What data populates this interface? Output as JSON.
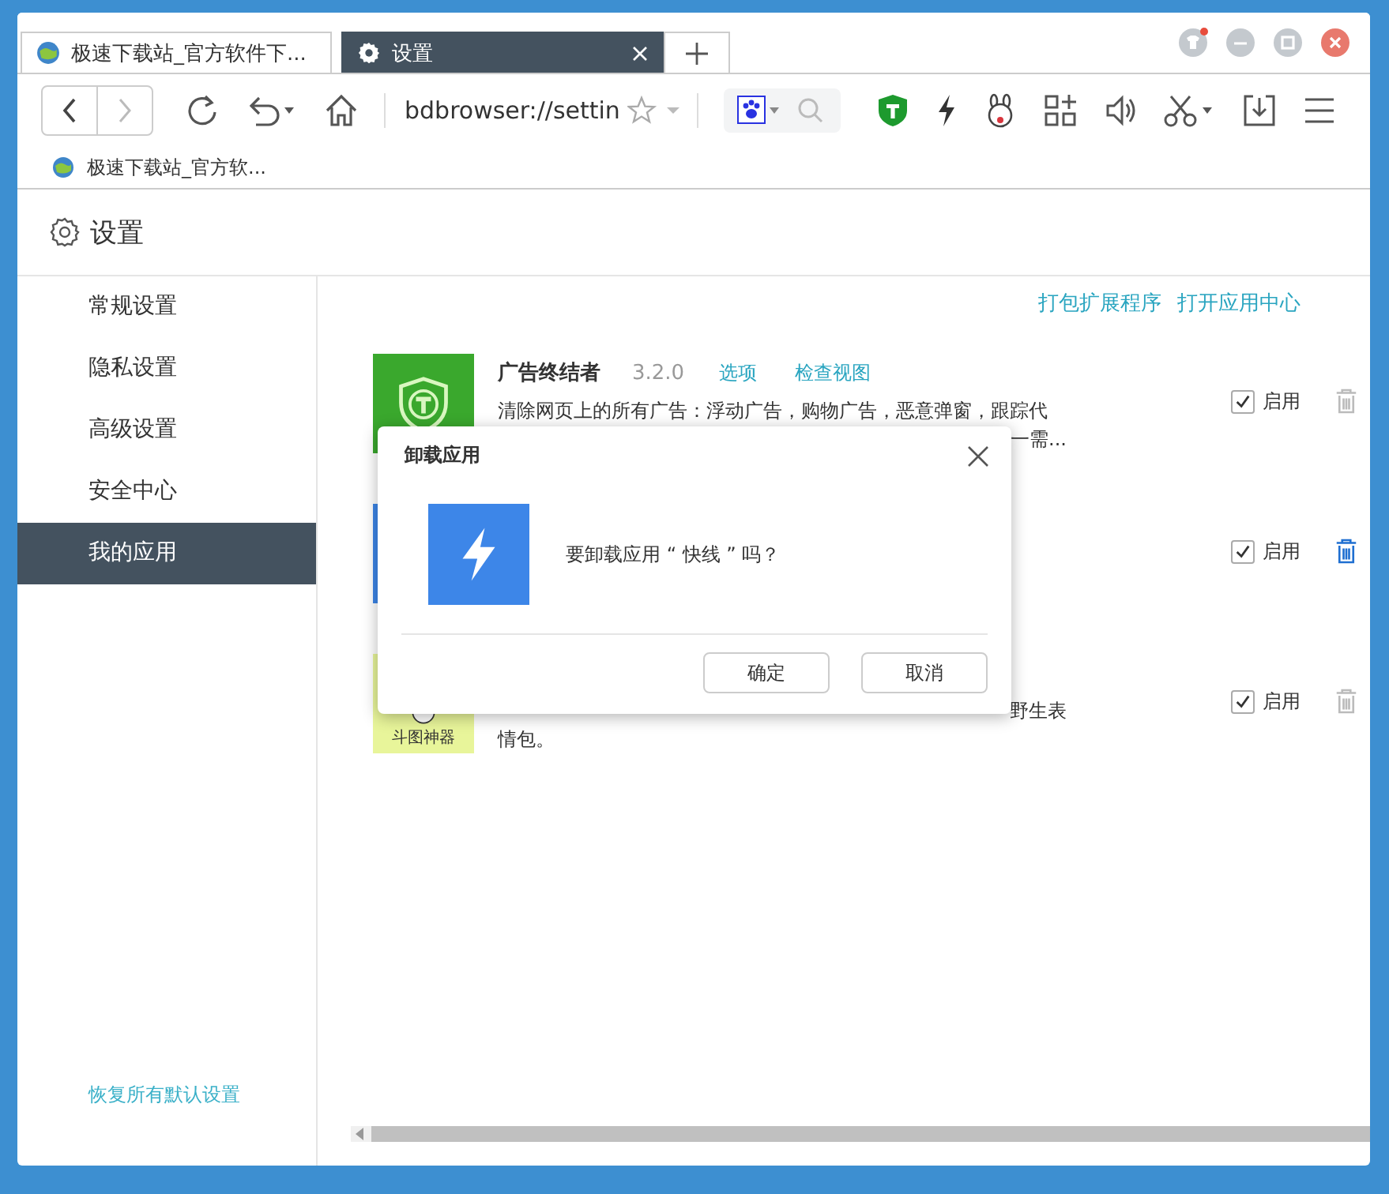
{
  "tabs": [
    {
      "title": "极速下载站_官方软件下...",
      "kind": "globe",
      "selected": false
    },
    {
      "title": "设置",
      "kind": "gear",
      "selected": true
    }
  ],
  "address": {
    "value": "bdbrowser://settin"
  },
  "bookmarks": [
    {
      "title": "极速下载站_官方软..."
    }
  ],
  "page_title": "设置",
  "sidebar": {
    "items": [
      {
        "label": "常规设置",
        "selected": false
      },
      {
        "label": "隐私设置",
        "selected": false
      },
      {
        "label": "高级设置",
        "selected": false
      },
      {
        "label": "安全中心",
        "selected": false
      },
      {
        "label": "我的应用",
        "selected": true
      }
    ],
    "footer_link": "恢复所有默认设置"
  },
  "header_links": [
    "打包扩展程序",
    "打开应用中心"
  ],
  "apps": [
    {
      "kind": "shield",
      "name": "广告终结者",
      "version": "3.2.0",
      "links": [
        "选项",
        "检查视图"
      ],
      "description_lines": [
        "清除网页上的所有广告：浮动广告，购物广告，恶意弹窗，跟踪代",
        "一需..."
      ],
      "enabled": true,
      "enable_label": "启用",
      "trash_active": false
    },
    {
      "kind": "bolt",
      "enabled": true,
      "enable_label": "启用",
      "trash_active": true
    },
    {
      "kind": "doutu",
      "icon_label": "斗图神器",
      "description_lines": [
        "野生表",
        "情包。"
      ],
      "enabled": true,
      "enable_label": "启用",
      "trash_active": false
    }
  ],
  "dialog": {
    "title": "卸载应用",
    "kind": "bolt",
    "message": "要卸载应用 “ 快线 ” 吗？",
    "buttons": [
      "确定",
      "取消"
    ]
  }
}
